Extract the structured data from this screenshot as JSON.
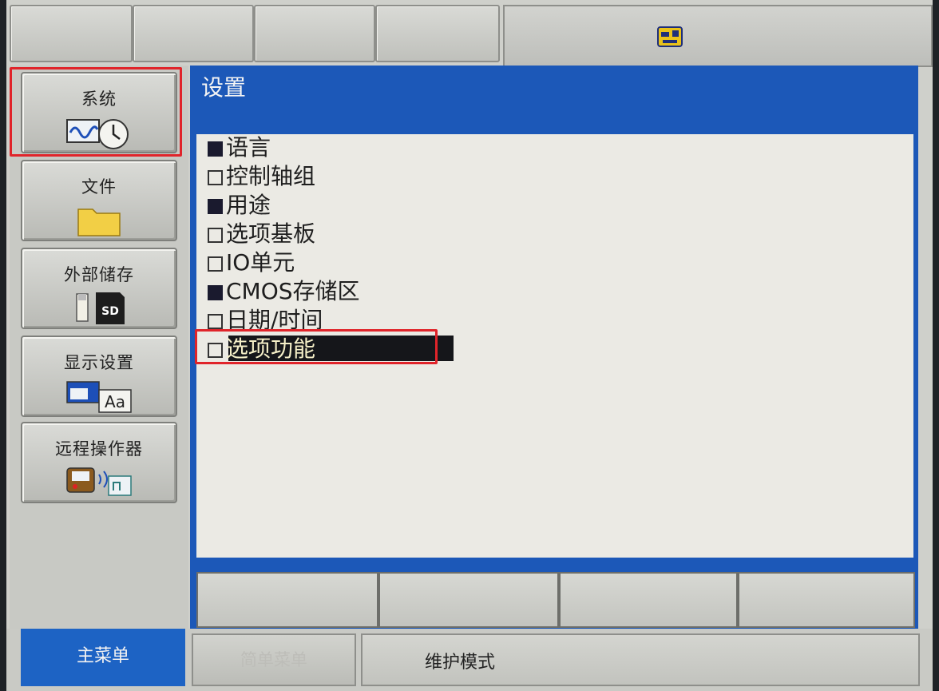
{
  "top_tabs": [
    "",
    "",
    "",
    ""
  ],
  "sidebar": {
    "items": [
      {
        "label": "系统",
        "icon": "waveform-clock-icon"
      },
      {
        "label": "文件",
        "icon": "folder-icon"
      },
      {
        "label": "外部储存",
        "icon": "usb-sd-card-icon"
      },
      {
        "label": "显示设置",
        "icon": "display-font-icon"
      },
      {
        "label": "远程操作器",
        "icon": "remote-pendant-icon"
      }
    ]
  },
  "panel": {
    "title": "设置",
    "items": [
      {
        "label": "语言",
        "checked": true
      },
      {
        "label": "控制轴组",
        "checked": false
      },
      {
        "label": "用途",
        "checked": true
      },
      {
        "label": "选项基板",
        "checked": false
      },
      {
        "label": "IO单元",
        "checked": false
      },
      {
        "label": "CMOS存储区",
        "checked": true
      },
      {
        "label": "日期/时间",
        "checked": false
      },
      {
        "label": "选项功能",
        "checked": false,
        "selected": true
      }
    ]
  },
  "bottom_buttons": [
    "",
    "",
    "",
    ""
  ],
  "status": {
    "main_menu": "主菜单",
    "simple_menu": "简单菜单",
    "mode": "维护模式"
  },
  "colors": {
    "panel_blue": "#1c58b8",
    "highlight_red": "#e0242a",
    "selection_bar": "#15161a"
  }
}
